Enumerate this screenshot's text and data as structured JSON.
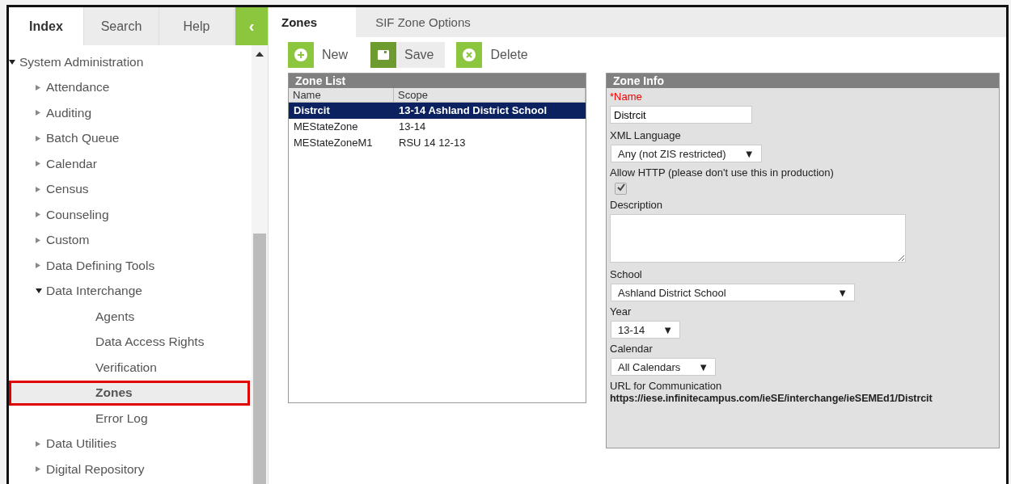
{
  "sidebar": {
    "tabs": [
      {
        "label": "Index",
        "selected": true
      },
      {
        "label": "Search",
        "selected": false
      },
      {
        "label": "Help",
        "selected": false
      }
    ],
    "collapse_button": "‹",
    "tree": [
      {
        "label": "System Administration",
        "kind": "folder",
        "expanded": true,
        "children": [
          {
            "label": "Attendance",
            "kind": "folder",
            "expanded": false
          },
          {
            "label": "Auditing",
            "kind": "folder",
            "expanded": false
          },
          {
            "label": "Batch Queue",
            "kind": "folder",
            "expanded": false
          },
          {
            "label": "Calendar",
            "kind": "folder",
            "expanded": false
          },
          {
            "label": "Census",
            "kind": "folder",
            "expanded": false
          },
          {
            "label": "Counseling",
            "kind": "folder",
            "expanded": false
          },
          {
            "label": "Custom",
            "kind": "folder",
            "expanded": false
          },
          {
            "label": "Data Defining Tools",
            "kind": "folder",
            "expanded": false
          },
          {
            "label": "Data Interchange",
            "kind": "folder",
            "expanded": true,
            "children": [
              {
                "label": "Agents",
                "kind": "page",
                "selected": false
              },
              {
                "label": "Data Access Rights",
                "kind": "page",
                "selected": false
              },
              {
                "label": "Verification",
                "kind": "page",
                "selected": false
              },
              {
                "label": "Zones",
                "kind": "page",
                "selected": true
              },
              {
                "label": "Error Log",
                "kind": "page",
                "selected": false
              }
            ]
          },
          {
            "label": "Data Utilities",
            "kind": "folder",
            "expanded": false
          },
          {
            "label": "Digital Repository",
            "kind": "folder",
            "expanded": false
          }
        ]
      }
    ]
  },
  "tabs": [
    {
      "label": "Zones",
      "selected": true
    },
    {
      "label": "SIF Zone Options",
      "selected": false
    }
  ],
  "toolbar": [
    {
      "label": "New",
      "kind": "new"
    },
    {
      "label": "Save",
      "kind": "save"
    },
    {
      "label": "Delete",
      "kind": "delete"
    }
  ],
  "zone_list": {
    "title": "Zone List",
    "columns": [
      "Name",
      "Scope"
    ],
    "rows": [
      {
        "cells": [
          "Distrcit",
          "13-14 Ashland District School"
        ],
        "selected": true
      },
      {
        "cells": [
          "MEStateZone",
          "13-14"
        ],
        "selected": false
      },
      {
        "cells": [
          "MEStateZoneM1",
          "RSU 14 12-13"
        ],
        "selected": false
      }
    ]
  },
  "zone_info": {
    "title": "Zone Info",
    "fields": [
      {
        "kind": "text",
        "label": "*Name",
        "required": true,
        "value": "Distrcit"
      },
      {
        "kind": "select",
        "label": "XML Language",
        "value": "Any (not ZIS restricted)",
        "arrow": "▼"
      },
      {
        "kind": "checkbox",
        "label": "Allow HTTP (please don't use this in production)",
        "checked": true,
        "disabled": true
      },
      {
        "kind": "textarea",
        "label": "Description"
      },
      {
        "kind": "wide-select",
        "label": "School",
        "value": "Ashland District School",
        "arrow": "▼"
      },
      {
        "kind": "select",
        "label": "Year",
        "value": "13-14",
        "arrow": "▼"
      },
      {
        "kind": "select",
        "label": "Calendar",
        "value": "All Calendars",
        "arrow": "▼"
      },
      {
        "kind": "static",
        "label": "URL for Communication",
        "value": "https://iese.infinitecampus.com/ieSE/interchange/ieSEMEd1/Distrcit"
      }
    ]
  }
}
